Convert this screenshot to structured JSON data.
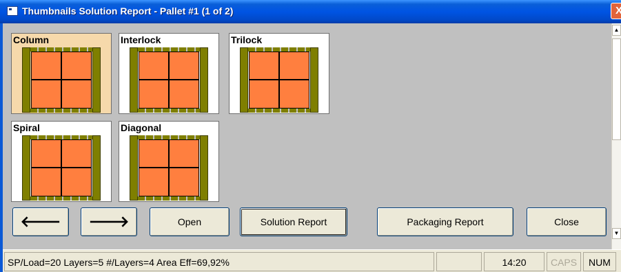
{
  "window": {
    "title": "Thumbnails Solution Report - Pallet #1 (1 of 2)",
    "close_glyph": "X"
  },
  "thumbnails": [
    {
      "label": "Column",
      "selected": true
    },
    {
      "label": "Interlock",
      "selected": false
    },
    {
      "label": "Trilock",
      "selected": false
    },
    {
      "label": "Spiral",
      "selected": false
    },
    {
      "label": "Diagonal",
      "selected": false
    }
  ],
  "colors": {
    "load": "#ff7f3f",
    "pallet": "#7f7f00",
    "selected_bg": "#f6d9ab"
  },
  "buttons": {
    "prev_glyph": "🡐",
    "next_glyph": "🡒",
    "open": "Open",
    "solution_report": "Solution Report",
    "packaging_report": "Packaging Report",
    "close": "Close"
  },
  "scrollbar": {
    "up_glyph": "▲",
    "down_glyph": "▼"
  },
  "status": {
    "main": "SP/Load=20 Layers=5 #/Layers=4 Area Eff=69,92%",
    "time": "14:20",
    "caps": "CAPS",
    "num": "NUM"
  }
}
